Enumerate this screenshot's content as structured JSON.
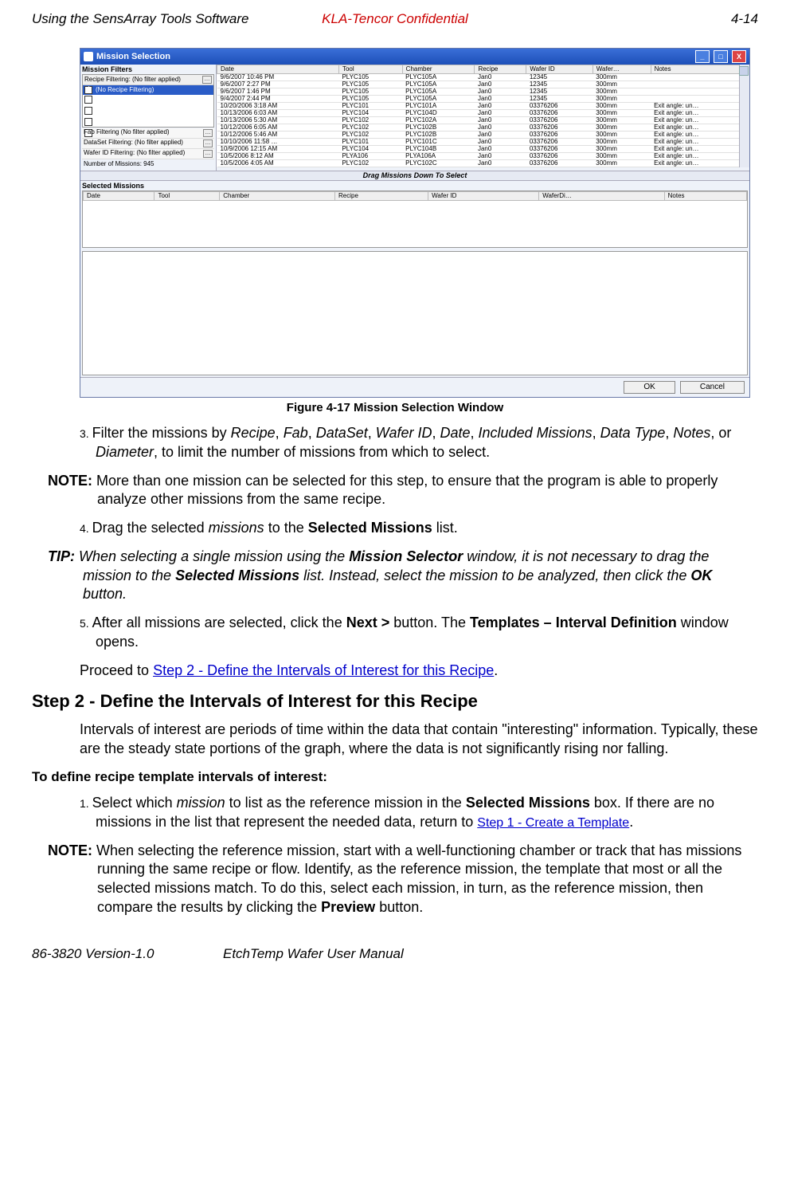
{
  "header": {
    "left": "Using the SensArray Tools Software",
    "center": "KLA-Tencor Confidential",
    "right": "4-14"
  },
  "footer": {
    "left": "86-3820 Version-1.0",
    "center": "EtchTemp Wafer User Manual"
  },
  "window": {
    "title": "Mission Selection",
    "min": "_",
    "max": "□",
    "close": "X",
    "filters_label": "Mission Filters",
    "recipe_filter_head": "Recipe Filtering: (No filter applied)",
    "recipe_filter_selected": "(No Recipe Filtering)",
    "fab_filter": "Fab Filtering (No filter applied)",
    "dataset_filter": "DataSet Filtering: (No filter applied)",
    "wafer_filter": "Wafer ID Filtering: (No filter applied)",
    "count": "Number of Missions: 945",
    "drag_label": "Drag Missions Down To Select",
    "selected_label": "Selected Missions",
    "ok": "OK",
    "cancel": "Cancel",
    "dots": "…"
  },
  "top_headers": [
    "Date",
    "Tool",
    "Chamber",
    "Recipe",
    "Wafer ID",
    "Wafer…",
    "Notes"
  ],
  "sel_headers": [
    "Date",
    "Tool",
    "Chamber",
    "Recipe",
    "Wafer ID",
    "WaferDi…",
    "Notes"
  ],
  "rows": [
    {
      "date": "9/6/2007 10:46 PM",
      "tool": "PLYC105",
      "chamber": "PLYC105A",
      "recipe": "Jan0",
      "wafer": "12345",
      "dia": "300mm",
      "notes": ""
    },
    {
      "date": "9/6/2007 2:27 PM",
      "tool": "PLYC105",
      "chamber": "PLYC105A",
      "recipe": "Jan0",
      "wafer": "12345",
      "dia": "300mm",
      "notes": ""
    },
    {
      "date": "9/6/2007 1:46 PM",
      "tool": "PLYC105",
      "chamber": "PLYC105A",
      "recipe": "Jan0",
      "wafer": "12345",
      "dia": "300mm",
      "notes": ""
    },
    {
      "date": "9/4/2007 2:44 PM",
      "tool": "PLYC105",
      "chamber": "PLYC105A",
      "recipe": "Jan0",
      "wafer": "12345",
      "dia": "300mm",
      "notes": ""
    },
    {
      "date": "10/20/2006 3:18 AM",
      "tool": "PLYC101",
      "chamber": "PLYC101A",
      "recipe": "Jan0",
      "wafer": "03376206",
      "dia": "300mm",
      "notes": "Exit angle: un…"
    },
    {
      "date": "10/13/2006 6:03 AM",
      "tool": "PLYC104",
      "chamber": "PLYC104D",
      "recipe": "Jan0",
      "wafer": "03376206",
      "dia": "300mm",
      "notes": "Exit angle: un…"
    },
    {
      "date": "10/13/2006 5:30 AM",
      "tool": "PLYC102",
      "chamber": "PLYC102A",
      "recipe": "Jan0",
      "wafer": "03376206",
      "dia": "300mm",
      "notes": "Exit angle: un…"
    },
    {
      "date": "10/12/2006 6:05 AM",
      "tool": "PLYC102",
      "chamber": "PLYC102B",
      "recipe": "Jan0",
      "wafer": "03376206",
      "dia": "300mm",
      "notes": "Exit angle: un…"
    },
    {
      "date": "10/12/2006 5:46 AM",
      "tool": "PLYC102",
      "chamber": "PLYC102B",
      "recipe": "Jan0",
      "wafer": "03376206",
      "dia": "300mm",
      "notes": "Exit angle: un…"
    },
    {
      "date": "10/10/2006 11:58 …",
      "tool": "PLYC101",
      "chamber": "PLYC101C",
      "recipe": "Jan0",
      "wafer": "03376206",
      "dia": "300mm",
      "notes": "Exit angle: un…"
    },
    {
      "date": "10/9/2006 12:15 AM",
      "tool": "PLYC104",
      "chamber": "PLYC104B",
      "recipe": "Jan0",
      "wafer": "03376206",
      "dia": "300mm",
      "notes": "Exit angle: un…"
    },
    {
      "date": "10/5/2006 8:12 AM",
      "tool": "PLYA106",
      "chamber": "PLYA106A",
      "recipe": "Jan0",
      "wafer": "03376206",
      "dia": "300mm",
      "notes": "Exit angle: un…"
    },
    {
      "date": "10/5/2006 4:05 AM",
      "tool": "PLYC102",
      "chamber": "PLYC102C",
      "recipe": "Jan0",
      "wafer": "03376206",
      "dia": "300mm",
      "notes": "Exit angle: un…"
    }
  ],
  "caption": "Figure 4-17 Mission Selection Window",
  "step3_num": "3. ",
  "step3_a": "Filter the missions by ",
  "step3_b": "Recipe",
  "step3_c": ", ",
  "step3_d": "Fab",
  "step3_e": ", ",
  "step3_f": "DataSet",
  "step3_g": ", ",
  "step3_h": "Wafer ID",
  "step3_i": ", ",
  "step3_j": "Date",
  "step3_k": ", ",
  "step3_l": "Included Missions",
  "step3_m": ", ",
  "step3_n": "Data Type",
  "step3_o": ", ",
  "step3_p": "Notes",
  "step3_q": ", or ",
  "step3_r": "Diameter",
  "step3_s": ", to limit the number of missions from which to select.",
  "note1_a": "NOTE: ",
  "note1_b": "More than one mission can be selected for this step, to ensure that the program is able to properly analyze other missions from the same recipe.",
  "step4_num": "4. ",
  "step4_a": "Drag the selected ",
  "step4_b": "missions",
  "step4_c": " to the ",
  "step4_d": "Selected Missions",
  "step4_e": " list.",
  "tip_a": "TIP: ",
  "tip_b": "When selecting a single mission using the ",
  "tip_c": "Mission Selector",
  "tip_d": " window, it is not necessary to drag the mission to the ",
  "tip_e": "Selected Missions",
  "tip_f": " list. Instead, select the mission to be analyzed, then click the ",
  "tip_g": "OK",
  "tip_h": " button.",
  "step5_num": "5. ",
  "step5_a": "After all missions are selected, click the ",
  "step5_b": "Next >",
  "step5_c": " button. The ",
  "step5_d": "Templates – Interval Definition",
  "step5_e": " window opens.",
  "proceed_a": "Proceed to ",
  "proceed_link": "Step 2 - Define the Intervals of Interest for this Recipe",
  "proceed_b": ".",
  "h2": "Step 2 - Define the Intervals of Interest for this Recipe",
  "intro2": "Intervals of interest are periods of time within the data that contain \"interesting\" information. Typically, these are the steady state portions of the graph, where the data is not significantly rising nor falling.",
  "subhead": "To define recipe template intervals of interest:",
  "b1_num": "1. ",
  "b1_a": "Select which ",
  "b1_b": "mission",
  "b1_c": " to list as the reference mission in the ",
  "b1_d": "Selected Missions",
  "b1_e": " box. If there are no missions in the list that represent the needed data, return to ",
  "b1_link": "Step 1 - Create a Template",
  "b1_f": ".",
  "note2_a": "NOTE: ",
  "note2_b": "When selecting the reference mission, start with a well-functioning chamber or track that has missions running the same recipe or flow. Identify, as the reference mission, the template that most or all the selected missions match. To do this, select each mission, in turn, as the reference mission, then compare the results by clicking the ",
  "note2_c": "Preview",
  "note2_d": " button."
}
